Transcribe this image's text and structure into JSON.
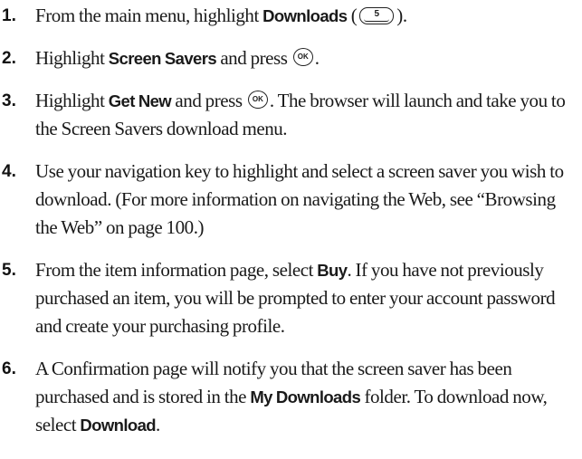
{
  "steps": [
    {
      "number": "1.",
      "t1": "From the main menu, highlight ",
      "b1": "Downloads",
      "t2": " (",
      "key": "5",
      "t3": ")."
    },
    {
      "number": "2.",
      "t1": "Highlight ",
      "b1": "Screen Savers",
      "t2": " and press ",
      "key": "OK",
      "t3": "."
    },
    {
      "number": "3.",
      "t1": "Highlight ",
      "b1": "Get New",
      "t2": " and press ",
      "key": "OK",
      "t3": ". The browser will launch and take you to the Screen Savers download menu."
    },
    {
      "number": "4.",
      "text": "Use your navigation key to highlight and select a screen saver you wish to download. (For more information on navigating the Web, see “Browsing the Web” on page 100.)"
    },
    {
      "number": "5.",
      "t1": "From the item information page, select ",
      "b1": "Buy",
      "t2": ". If you have not previously purchased an item, you will be prompted to enter your account password and create your purchasing profile."
    },
    {
      "number": "6.",
      "t1": "A Confirmation page will notify you that the screen saver has been purchased and is stored in the ",
      "b1": "My Downloads",
      "t2": " folder. To download now, select ",
      "b2": "Download",
      "t3": "."
    }
  ],
  "icons": {
    "number_key": "keypad-5-icon",
    "ok_key": "ok-button-icon"
  }
}
